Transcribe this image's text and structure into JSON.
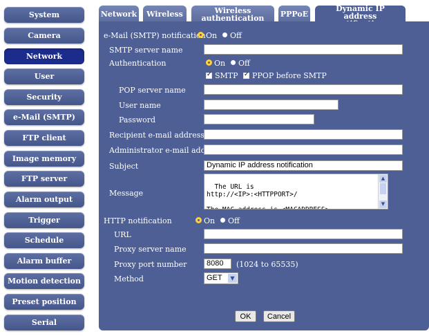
{
  "sidebar": {
    "items": [
      {
        "label": "System"
      },
      {
        "label": "Camera"
      },
      {
        "label": "Network"
      },
      {
        "label": "User"
      },
      {
        "label": "Security"
      },
      {
        "label": "e-Mail (SMTP)"
      },
      {
        "label": "FTP client"
      },
      {
        "label": "Image memory"
      },
      {
        "label": "FTP server"
      },
      {
        "label": "Alarm output"
      },
      {
        "label": "Trigger"
      },
      {
        "label": "Schedule"
      },
      {
        "label": "Alarm buffer"
      },
      {
        "label": "Motion detection"
      },
      {
        "label": "Preset position"
      },
      {
        "label": "Serial"
      }
    ],
    "active": "Network"
  },
  "tabs": [
    {
      "label": "Network"
    },
    {
      "label": "Wireless"
    },
    {
      "label": "Wireless authentication"
    },
    {
      "label": "PPPoE"
    },
    {
      "label": "Dynamic IP address notification"
    }
  ],
  "form": {
    "smtp_notification": {
      "label": "e-Mail (SMTP) notification",
      "on": "On",
      "off": "Off",
      "selected": "On"
    },
    "smtp_server_name": {
      "label": "SMTP server name",
      "value": ""
    },
    "authentication": {
      "label": "Authentication",
      "on": "On",
      "off": "Off",
      "selected": "On"
    },
    "auth_methods": {
      "smtp": "SMTP",
      "ppop": "PPOP before SMTP",
      "smtp_checked": true,
      "ppop_checked": true
    },
    "pop_server_name": {
      "label": "POP server name",
      "value": ""
    },
    "user_name": {
      "label": "User name",
      "value": ""
    },
    "password": {
      "label": "Password",
      "value": ""
    },
    "recipient": {
      "label": "Recipient e-mail address",
      "value": ""
    },
    "admin": {
      "label": "Administrator e-mail address",
      "value": ""
    },
    "subject": {
      "label": "Subject",
      "value": "Dynamic IP address notification"
    },
    "message": {
      "label": "Message",
      "value": "The URL is\nhttp://<IP>:<HTTPPORT>/\n\nThe MAC address is <MACADDRESS>."
    },
    "http_notification": {
      "label": "HTTP notification",
      "on": "On",
      "off": "Off",
      "selected": "On"
    },
    "url": {
      "label": "URL",
      "value": ""
    },
    "proxy_server_name": {
      "label": "Proxy server name",
      "value": ""
    },
    "proxy_port": {
      "label": "Proxy port number",
      "value": "8080",
      "range": "(1024 to 65535)"
    },
    "method": {
      "label": "Method",
      "value": "GET"
    }
  },
  "buttons": {
    "ok": "OK",
    "cancel": "Cancel"
  },
  "colors": {
    "panel": "#4d5f94",
    "active_sidebar": "#1c2c8c",
    "radio_selected": "#ffd23c"
  }
}
